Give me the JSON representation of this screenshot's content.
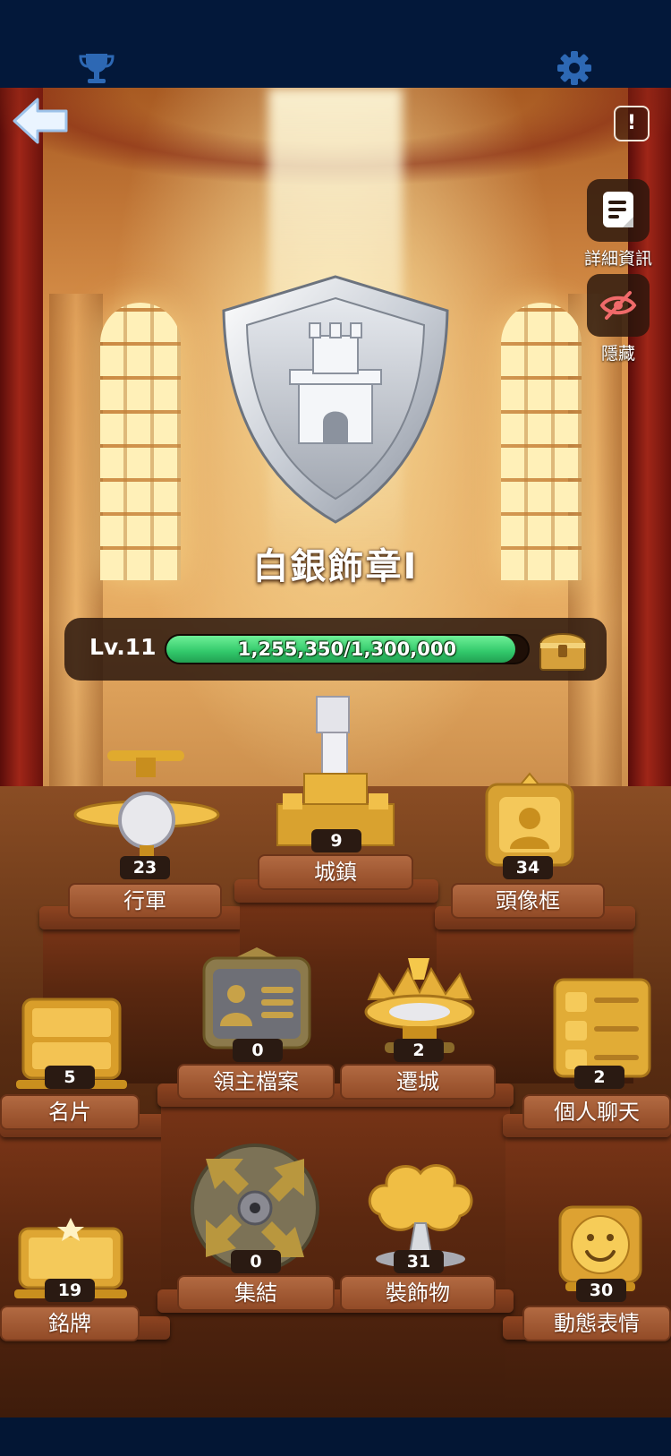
{
  "topbar": {
    "left_icon": "trophy-icon",
    "right_icon": "gear-icon"
  },
  "header": {
    "back_icon": "back-arrow-icon",
    "alert_label": "!"
  },
  "side_buttons": [
    {
      "icon": "document-icon",
      "label": "詳細資訊"
    },
    {
      "icon": "eye-off-icon",
      "label": "隱藏"
    }
  ],
  "badge": {
    "title": "白銀飾章I",
    "icon": "silver-castle-shield-icon"
  },
  "level": {
    "label": "Lv.11",
    "progress_text": "1,255,350/1,300,000",
    "current": 1255350,
    "max": 1300000,
    "chest_icon": "treasure-chest-icon"
  },
  "items": [
    {
      "label": "行軍",
      "count": "23",
      "icon": "gold-airplane-icon"
    },
    {
      "label": "城鎮",
      "count": "9",
      "icon": "gold-castle-icon"
    },
    {
      "label": "頭像框",
      "count": "34",
      "icon": "gold-avatar-frame-icon"
    },
    {
      "label": "名片",
      "count": "5",
      "icon": "gold-name-card-icon"
    },
    {
      "label": "領主檔案",
      "count": "0",
      "icon": "lord-profile-card-icon"
    },
    {
      "label": "遷城",
      "count": "2",
      "icon": "relocation-crown-icon"
    },
    {
      "label": "個人聊天",
      "count": "2",
      "icon": "chat-bubble-list-icon"
    },
    {
      "label": "銘牌",
      "count": "19",
      "icon": "gold-nameplate-icon"
    },
    {
      "label": "集結",
      "count": "0",
      "icon": "rally-arrows-icon"
    },
    {
      "label": "裝飾物",
      "count": "31",
      "icon": "gold-tree-icon"
    },
    {
      "label": "動態表情",
      "count": "30",
      "icon": "smiley-emote-icon"
    }
  ],
  "colors": {
    "progress_green": "#31c86a",
    "gold": "#f1c84a",
    "navy": "#03183a"
  }
}
